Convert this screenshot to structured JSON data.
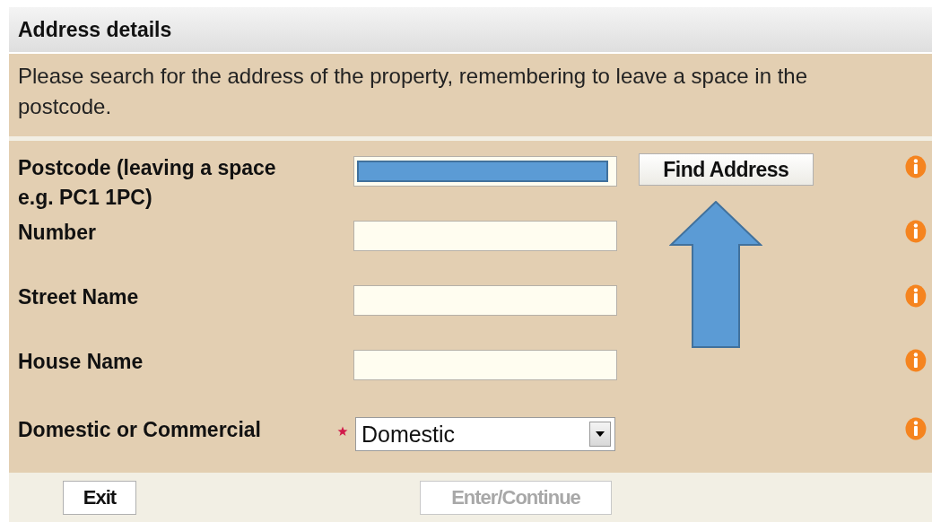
{
  "section": {
    "title": "Address details"
  },
  "instructions": "Please search for the address of the property, remembering to leave a space in the postcode.",
  "fields": [
    {
      "kind": "text",
      "label": "Postcode (leaving a space e.g. PC1 1PC)",
      "redacted": true,
      "button": "Find Address"
    },
    {
      "kind": "text",
      "label": "Number",
      "redacted": false
    },
    {
      "kind": "text",
      "label": "Street Name",
      "redacted": false
    },
    {
      "kind": "text",
      "label": "House Name",
      "redacted": false
    },
    {
      "kind": "select",
      "label": "Domestic or Commercial",
      "required": true,
      "value": "Domestic"
    }
  ],
  "buttons": [
    {
      "label": "Exit",
      "disabled": false
    },
    {
      "label": "Enter/Continue",
      "disabled": true
    }
  ]
}
